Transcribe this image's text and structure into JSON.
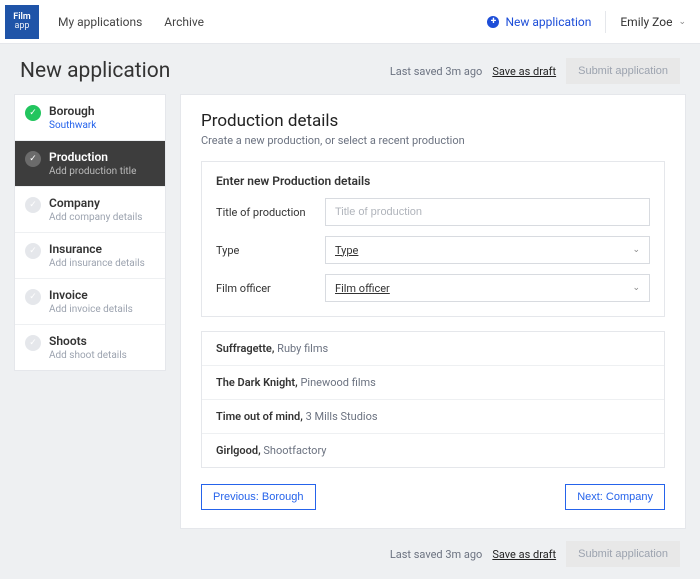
{
  "nav": {
    "logo_top": "Film",
    "logo_bottom": "app",
    "links": [
      "My applications",
      "Archive"
    ],
    "new_app": "New application",
    "user_name": "Emily Zoe"
  },
  "header": {
    "title": "New application",
    "last_saved": "Last saved 3m ago",
    "save_draft": "Save as draft",
    "submit": "Submit application"
  },
  "steps": [
    {
      "title": "Borough",
      "sub": "Southwark",
      "state": "done"
    },
    {
      "title": "Production",
      "sub": "Add production title",
      "state": "active"
    },
    {
      "title": "Company",
      "sub": "Add company details",
      "state": ""
    },
    {
      "title": "Insurance",
      "sub": "Add insurance details",
      "state": ""
    },
    {
      "title": "Invoice",
      "sub": "Add invoice details",
      "state": ""
    },
    {
      "title": "Shoots",
      "sub": "Add shoot details",
      "state": ""
    }
  ],
  "main": {
    "heading": "Production details",
    "subtitle": "Create a new production, or select a recent production",
    "panel_title": "Enter new Production details",
    "form": {
      "title_label": "Title of production",
      "title_placeholder": "Title of production",
      "type_label": "Type",
      "type_placeholder": "Type",
      "officer_label": "Film officer",
      "officer_placeholder": "Film officer"
    },
    "recent": [
      {
        "title": "Suffragette",
        "company": "Ruby films"
      },
      {
        "title": "The Dark Knight",
        "company": "Pinewood films"
      },
      {
        "title": "Time out of mind",
        "company": "3 Mills Studios"
      },
      {
        "title": "Girlgood",
        "company": "Shootfactory"
      }
    ],
    "prev": "Previous: Borough",
    "next": "Next: Company"
  }
}
